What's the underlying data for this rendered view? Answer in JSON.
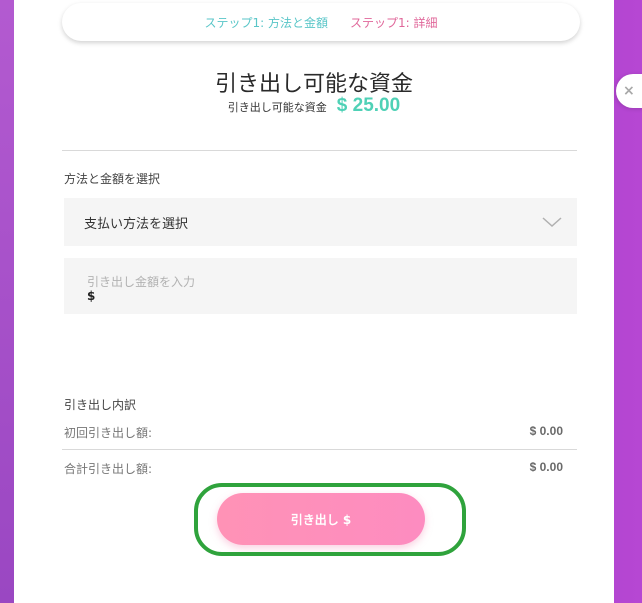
{
  "steps": {
    "step1": "ステップ1: 方法と金額",
    "step2": "ステップ1: 詳細"
  },
  "header": {
    "title": "引き出し可能な資金",
    "balance_label": "引き出し可能な資金",
    "balance_amount": "$ 25.00"
  },
  "form": {
    "section_label": "方法と金額を選択",
    "method_select_text": "支払い方法を選択",
    "amount_placeholder": "引き出し金額を入力",
    "amount_currency": "$"
  },
  "breakdown": {
    "title": "引き出し内訳",
    "rows": [
      {
        "label": "初回引き出し額:",
        "value": "$ 0.00"
      },
      {
        "label": "合計引き出し額:",
        "value": "$ 0.00"
      }
    ]
  },
  "actions": {
    "withdraw_label": "引き出し $",
    "close_label": "×"
  },
  "colors": {
    "accent_teal": "#4fd1b6",
    "accent_pink": "#fd8cc0",
    "highlight_green": "#2fa33c"
  },
  "icons": {
    "chevron": "chevron-down-icon",
    "close": "close-icon"
  }
}
